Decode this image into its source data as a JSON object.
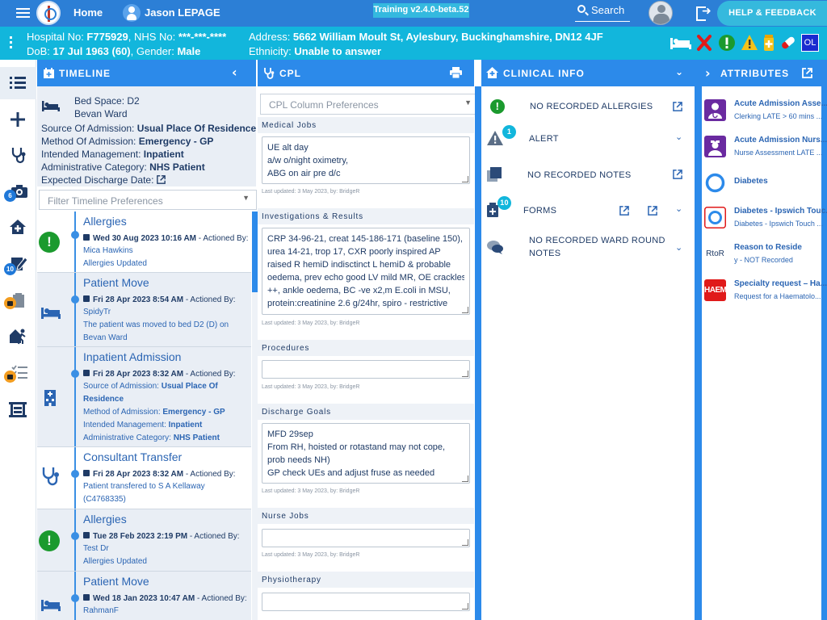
{
  "topbar": {
    "home_label": "Home",
    "user_name": "Jason LEPAGE",
    "version": "Training v2.4.0-beta.52",
    "search_label": "Search",
    "help_label": "HELP & FEEDBACK"
  },
  "banner": {
    "line1": {
      "k1": "Hospital No: ",
      "v1": "F775929",
      "k2": ", NHS No: ",
      "v2": "***-***-****"
    },
    "line2": {
      "k1": "DoB: ",
      "v1": "17 Jul 1963 (60)",
      "k2": ", Gender: ",
      "v2": "Male"
    },
    "address": {
      "k": "Address: ",
      "v": "5662 William Moult St, Aylesbury, Buckinghamshire, DN12 4JF"
    },
    "ethnicity": {
      "k": "Ethnicity: ",
      "v": "Unable to answer"
    },
    "initials_badge": "OL"
  },
  "rail": {
    "badges": {
      "camera": "6",
      "notes": "10"
    }
  },
  "panels": {
    "timeline": "TIMELINE",
    "cpl": "CPL",
    "clinical": "CLINICAL INFO",
    "attributes": "ATTRIBUTES"
  },
  "timeline_info": {
    "bed_space": "Bed Space: D2",
    "ward": "Bevan Ward",
    "source": {
      "k": "Source Of Admission: ",
      "v": "Usual Place Of Residence"
    },
    "method": {
      "k": "Method Of Admission: ",
      "v": "Emergency - GP"
    },
    "management": {
      "k": "Intended Management: ",
      "v": "Inpatient"
    },
    "category": {
      "k": "Administrative Category: ",
      "v": "NHS Patient"
    },
    "discharge": "Expected Discharge Date:",
    "filter_placeholder": "Filter Timeline Preferences"
  },
  "timeline": [
    {
      "title": "Allergies",
      "date": "Wed 30 Aug 2023 10:16 AM",
      "by": " - Actioned By:",
      "lines": [
        "Mica Hawkins",
        "Allergies Updated"
      ]
    },
    {
      "title": "Patient Move",
      "date": "Fri 28 Apr 2023 8:54 AM",
      "by": " - Actioned By:",
      "lines": [
        "SpidyTr",
        "The patient was moved to bed D2 (D) on",
        "Bevan Ward"
      ]
    },
    {
      "title": "Inpatient Admission",
      "date": "Fri 28 Apr 2023 8:32 AM",
      "by": " - Actioned By:",
      "kv": [
        {
          "k": "Source of Admission: ",
          "v": "Usual Place Of"
        },
        {
          "k": "",
          "v": "Residence"
        },
        {
          "k": "Method of Admission: ",
          "v": "Emergency - GP"
        },
        {
          "k": "Intended Management: ",
          "v": "Inpatient"
        },
        {
          "k": "Administrative Category: ",
          "v": "NHS Patient"
        }
      ]
    },
    {
      "title": "Consultant Transfer",
      "date": "Fri 28 Apr 2023 8:32 AM",
      "by": " - Actioned By:",
      "lines": [
        "Patient transfered to S A Kellaway",
        "(C4768335)"
      ]
    },
    {
      "title": "Allergies",
      "date": "Tue 28 Feb 2023 2:19 PM",
      "by": " - Actioned By:",
      "lines": [
        "Test Dr",
        "Allergies Updated"
      ]
    },
    {
      "title": "Patient Move",
      "date": "Wed 18 Jan 2023 10:47 AM",
      "by": " - Actioned By:",
      "lines": [
        "RahmanF"
      ]
    }
  ],
  "cpl": {
    "select_placeholder": "CPL Column Preferences",
    "sections": [
      {
        "title": "Medical Jobs",
        "text": [
          "UE alt day",
          "a/w o/night oximetry,",
          "ABG on air pre d/c"
        ],
        "updated": "Last updated: 3 May 2023, by: BridgeR"
      },
      {
        "title": "Investigations & Results",
        "text": [
          "CRP 34-96-21, creat 145-186-171 (baseline 150),",
          "urea 14-21, trop 17, CXR poorly inspired AP",
          "raised R hemiD indisctinct L hemiD & probable",
          "oedema, prev echo good LV mild MR, OE crackles",
          "++, ankle oedema, BC -ve x2,m E.coli in MSU,",
          "protein:creatinine 2.6 g/24hr, spiro - restrictive"
        ],
        "updated": "Last updated: 3 May 2023, by: BridgeR"
      },
      {
        "title": "Procedures",
        "text": [],
        "updated": "Last updated: 3 May 2023, by: BridgeR"
      },
      {
        "title": "Discharge Goals",
        "text": [
          "MFD 29sep",
          "From RH, hoisted or rotastand may not cope,",
          "prob needs NH)",
          "GP check UEs and adjust fruse as needed"
        ],
        "updated": "Last updated: 3 May 2023, by: BridgeR"
      },
      {
        "title": "Nurse Jobs",
        "text": [],
        "updated": "Last updated: 3 May 2023, by: BridgeR"
      },
      {
        "title": "Physiotherapy",
        "text": [],
        "updated": ""
      }
    ]
  },
  "clinical": {
    "allergies": "NO RECORDED ALLERGIES",
    "alert": "ALERT",
    "alert_count": "1",
    "notes": "NO RECORDED NOTES",
    "forms": "FORMS",
    "forms_count": "10",
    "ward_round_1": "NO RECORDED WARD ROUND",
    "ward_round_2": "NOTES"
  },
  "attributes": [
    {
      "title": "Acute Admission Asse...",
      "sub": "Clerking LATE > 60 mins ...",
      "icon": "doctor-icon"
    },
    {
      "title": "Acute Admission Nurs...",
      "sub": "Nurse Assessment LATE ...",
      "icon": "nurse-icon"
    },
    {
      "title": "Diabetes",
      "sub": "",
      "icon": "diabetes-ring-icon"
    },
    {
      "title": "Diabetes - Ipswich Touc...",
      "sub": "Diabetes - Ipswich Touch ...",
      "icon": "diabetes-touch-icon"
    },
    {
      "title": "Reason to Reside",
      "sub": "y - NOT Recorded",
      "icon": "rtor-icon",
      "icon_text": "RtoR"
    },
    {
      "title": "Specialty request – Ha...",
      "sub": "Request for a Haematolo...",
      "icon": "haem-icon",
      "icon_text": "HAEM"
    }
  ],
  "colors": {
    "primary": "#2c8aea",
    "banner": "#12b6dc",
    "accent": "#35b9dd",
    "allergy_green": "#1b9a2e",
    "purple": "#6a2aa0",
    "red": "#e01a1a"
  }
}
